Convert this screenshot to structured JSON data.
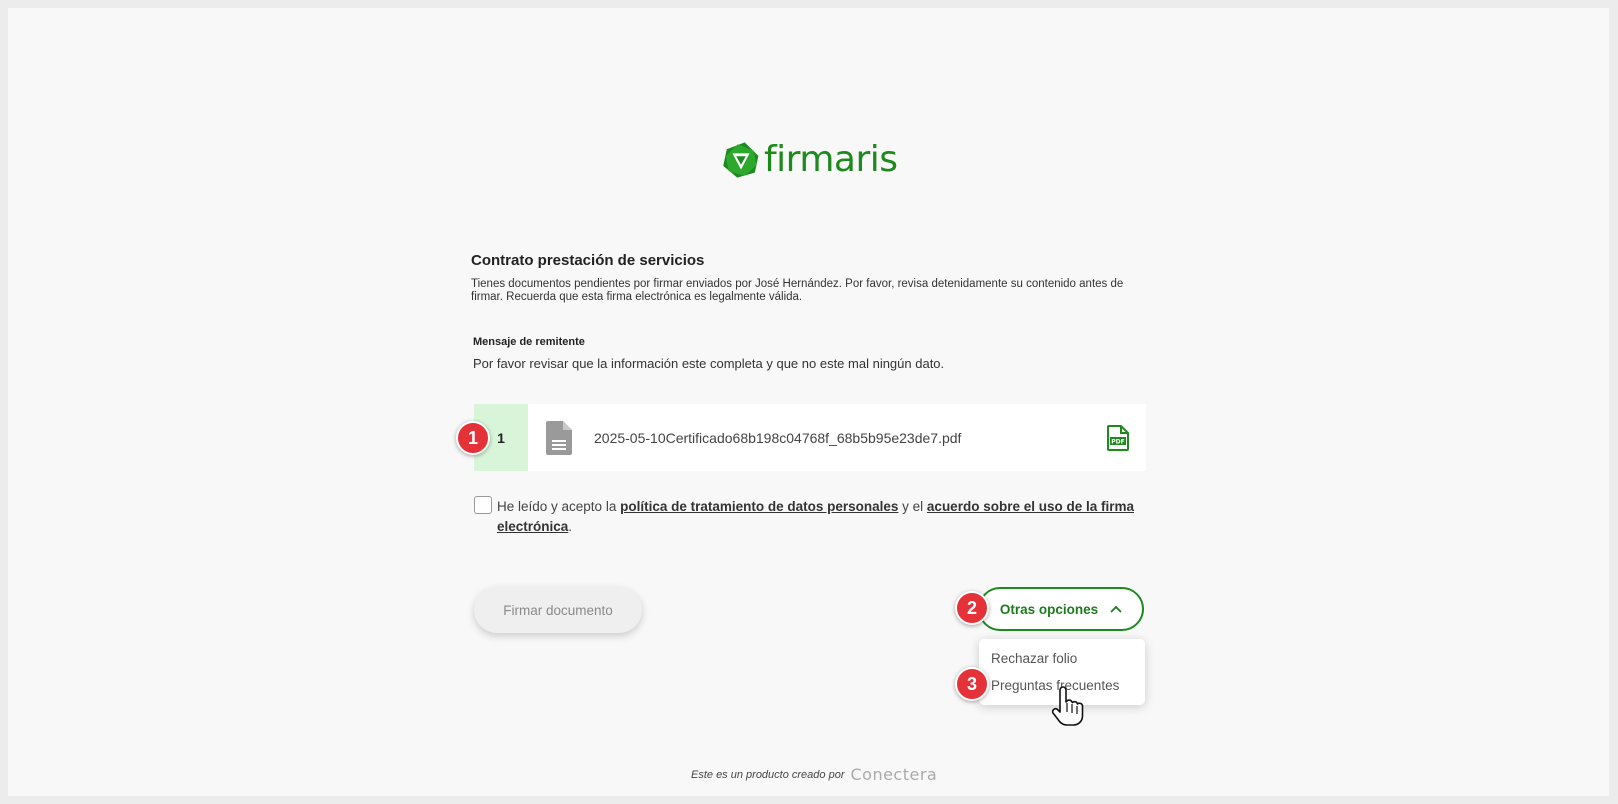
{
  "brand": {
    "name": "firmaris",
    "color": "#1e8a1e"
  },
  "document": {
    "title": "Contrato prestación de servicios",
    "intro": "Tienes documentos pendientes por firmar enviados por José Hernández. Por favor, revisa detenidamente su contenido antes de firmar. Recuerda que esta firma electrónica es legalmente válida.",
    "sender_message_label": "Mensaje de remitente",
    "sender_message": "Por favor revisar que la información este completa y que no este mal ningún dato.",
    "files": [
      {
        "index": "1",
        "name": "2025-05-10Certificado68b198c04768f_68b5b95e23de7.pdf",
        "icon": "file-icon",
        "action_icon": "pdf-icon"
      }
    ]
  },
  "consent": {
    "prefix": "He leído y acepto la ",
    "link1": "política de tratamiento de datos personales",
    "middle": " y el ",
    "link2": "acuerdo sobre el uso de la firma electrónica",
    "suffix": ".",
    "checked": false
  },
  "actions": {
    "sign_label": "Firmar documento",
    "other_options_label": "Otras opciones",
    "other_options_menu": [
      "Rechazar folio",
      "Preguntas frecuentes"
    ]
  },
  "annotations": {
    "badges": [
      "1",
      "2",
      "3"
    ],
    "badge_color": "#e53238"
  },
  "footer": {
    "text": "Este es un producto creado por",
    "maker": "Conectera"
  }
}
